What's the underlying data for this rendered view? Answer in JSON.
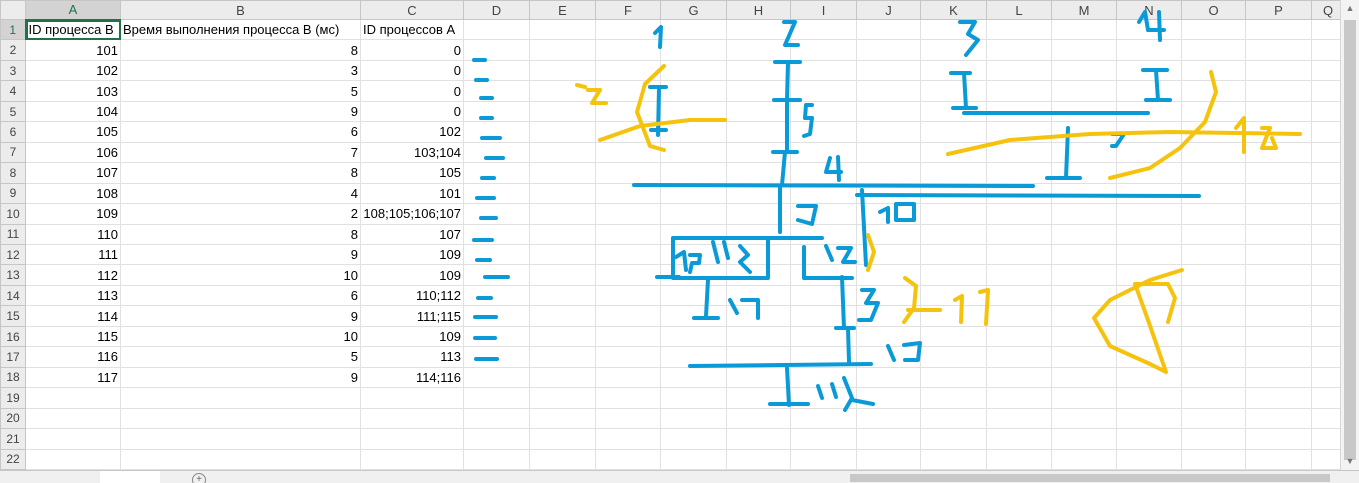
{
  "columns": [
    "A",
    "B",
    "C",
    "D",
    "E",
    "F",
    "G",
    "H",
    "I",
    "J",
    "K",
    "L",
    "M",
    "N",
    "O",
    "P",
    "Q"
  ],
  "rows": [
    {
      "n": "1",
      "a": "ID процесса B",
      "b": "Время выполнения процесса B (мс)",
      "c": "ID процессов A"
    },
    {
      "n": "2",
      "a": "101",
      "b": "8",
      "c": "0"
    },
    {
      "n": "3",
      "a": "102",
      "b": "3",
      "c": "0"
    },
    {
      "n": "4",
      "a": "103",
      "b": "5",
      "c": "0"
    },
    {
      "n": "5",
      "a": "104",
      "b": "9",
      "c": "0"
    },
    {
      "n": "6",
      "a": "105",
      "b": "6",
      "c": "102"
    },
    {
      "n": "7",
      "a": "106",
      "b": "7",
      "c": "103;104"
    },
    {
      "n": "8",
      "a": "107",
      "b": "8",
      "c": "105"
    },
    {
      "n": "9",
      "a": "108",
      "b": "4",
      "c": "101"
    },
    {
      "n": "10",
      "a": "109",
      "b": "2",
      "c": "108;105;106;107"
    },
    {
      "n": "11",
      "a": "110",
      "b": "8",
      "c": "107"
    },
    {
      "n": "12",
      "a": "111",
      "b": "9",
      "c": "109"
    },
    {
      "n": "13",
      "a": "112",
      "b": "10",
      "c": "109"
    },
    {
      "n": "14",
      "a": "113",
      "b": "6",
      "c": "110;112"
    },
    {
      "n": "15",
      "a": "114",
      "b": "9",
      "c": "111;115"
    },
    {
      "n": "16",
      "a": "115",
      "b": "10",
      "c": "109"
    },
    {
      "n": "17",
      "a": "116",
      "b": "5",
      "c": "113"
    },
    {
      "n": "18",
      "a": "117",
      "b": "9",
      "c": "114;116"
    },
    {
      "n": "19",
      "a": "",
      "b": "",
      "c": ""
    },
    {
      "n": "20",
      "a": "",
      "b": "",
      "c": ""
    },
    {
      "n": "21",
      "a": "",
      "b": "",
      "c": ""
    },
    {
      "n": "22",
      "a": "",
      "b": "",
      "c": ""
    }
  ],
  "ink": {
    "blue_color": "#0a9ad8",
    "yellow_color": "#f5c20c",
    "blue_labels": [
      "1",
      "2",
      "3",
      "4",
      "5",
      "6",
      "7",
      "9",
      "10",
      "11",
      "12",
      "13",
      "14",
      "15",
      "16",
      "17",
      "18"
    ],
    "yellow_labels": [
      "12",
      "16",
      "11"
    ]
  },
  "colors": {
    "accent": "#217346",
    "header_bg": "#ececec",
    "grid": "#e1e1e1"
  }
}
